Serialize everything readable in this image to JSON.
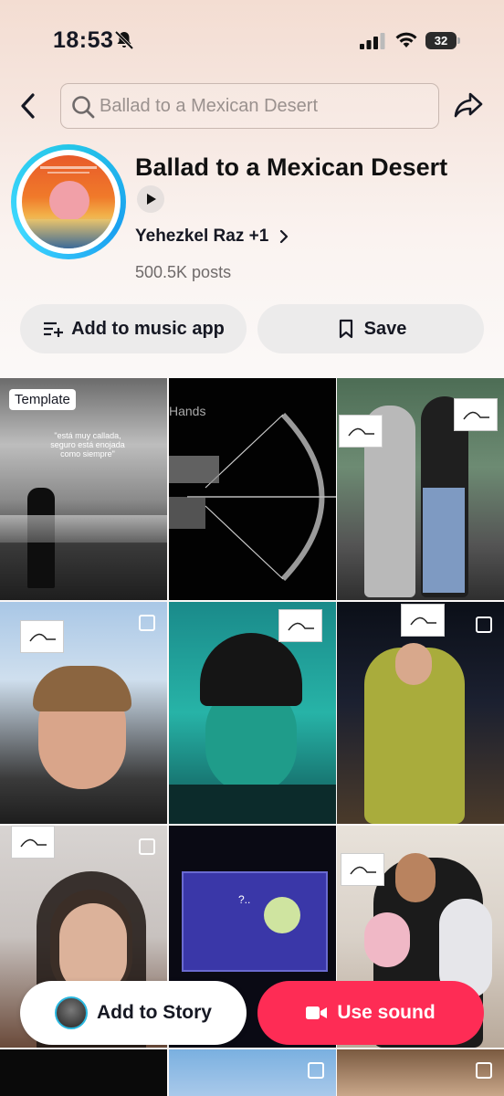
{
  "status_bar": {
    "time": "18:53",
    "battery": "32"
  },
  "search": {
    "placeholder": "Ballad to a Mexican Desert"
  },
  "sound": {
    "title": "Ballad to a Mexican Desert",
    "artist": "Yehezkel Raz +1",
    "posts": "500.5K posts"
  },
  "actions": {
    "add_to_music_app": "Add to music app",
    "save": "Save"
  },
  "grid": {
    "template_tag": "Template",
    "cell1_caption": "\"está muy callada,\nseguro está enojada\ncomo siempre\"",
    "cell2_caption": "Hands",
    "cell8_caption": "?.."
  },
  "bottom": {
    "add_to_story": "Add to Story",
    "use_sound": "Use sound"
  },
  "colors": {
    "accent": "#fe2c55",
    "ring": "#25c6e8"
  }
}
